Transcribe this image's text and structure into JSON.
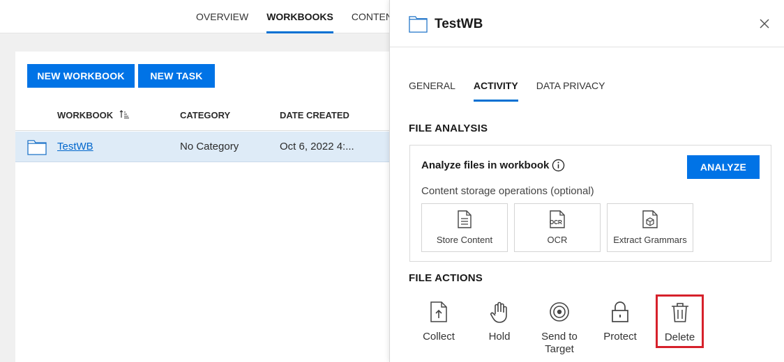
{
  "top_nav": {
    "tabs": [
      "OVERVIEW",
      "WORKBOOKS",
      "CONTENT"
    ],
    "active": "WORKBOOKS"
  },
  "toolbar": {
    "new_workbook_label": "NEW WORKBOOK",
    "new_task_label": "NEW TASK"
  },
  "table": {
    "columns": [
      "WORKBOOK",
      "CATEGORY",
      "DATE CREATED"
    ],
    "rows": [
      {
        "name": "TestWB",
        "category": "No Category",
        "date_created": "Oct 6, 2022 4:..."
      }
    ]
  },
  "panel": {
    "title": "TestWB",
    "tabs": [
      "GENERAL",
      "ACTIVITY",
      "DATA PRIVACY"
    ],
    "active_tab": "ACTIVITY",
    "file_analysis": {
      "heading": "FILE ANALYSIS",
      "box_title": "Analyze files in workbook",
      "analyze_label": "ANALYZE",
      "subtitle": "Content storage operations (optional)",
      "operations": [
        {
          "label": "Store Content",
          "icon": "document-icon"
        },
        {
          "label": "OCR",
          "icon": "ocr-icon"
        },
        {
          "label": "Extract Grammars",
          "icon": "grammar-icon"
        }
      ]
    },
    "file_actions": {
      "heading": "FILE ACTIONS",
      "actions": [
        {
          "label": "Collect",
          "icon": "upload-icon"
        },
        {
          "label": "Hold",
          "icon": "hand-icon"
        },
        {
          "label": "Send to Target",
          "icon": "target-icon"
        },
        {
          "label": "Protect",
          "icon": "lock-icon"
        },
        {
          "label": "Delete",
          "icon": "trash-icon"
        }
      ]
    }
  },
  "colors": {
    "accent": "#0073e6",
    "selected_row": "#deebf7",
    "highlight_border": "#d6212b"
  }
}
